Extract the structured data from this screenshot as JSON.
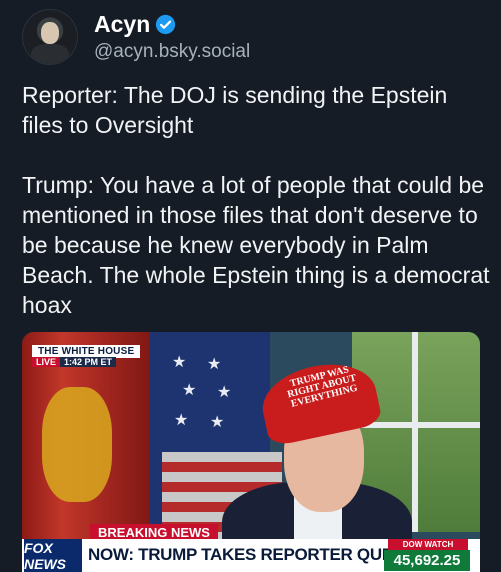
{
  "post": {
    "author": {
      "display_name": "Acyn",
      "handle": "@acyn.bsky.social",
      "verified": true,
      "avatar_icon": "avatar-image"
    },
    "text": {
      "paragraph1": "Reporter: The DOJ is sending the Epstein files to Oversight",
      "paragraph2": "Trump: You have a lot of people that could be mentioned in those files that don't deserve to be because he knew everybody in Palm Beach. The whole Epstein thing is a democrat hoax"
    },
    "media": {
      "corner_label": "THE WHITE HOUSE",
      "live_label": "LIVE",
      "time_label": "1:42 PM ET",
      "hat_text": "TRUMP WAS RIGHT ABOUT EVERYTHING",
      "breaking_label": "BREAKING NEWS",
      "network_logo": "FOX NEWS",
      "headline": "NOW: TRUMP TAKES REPORTER QUESTIONS",
      "dow_label": "DOW WATCH",
      "dow_value": "45,692.25"
    },
    "colors": {
      "background": "#151c26",
      "verified_badge": "#1d9bf0",
      "handle": "#a7b0bb"
    }
  }
}
